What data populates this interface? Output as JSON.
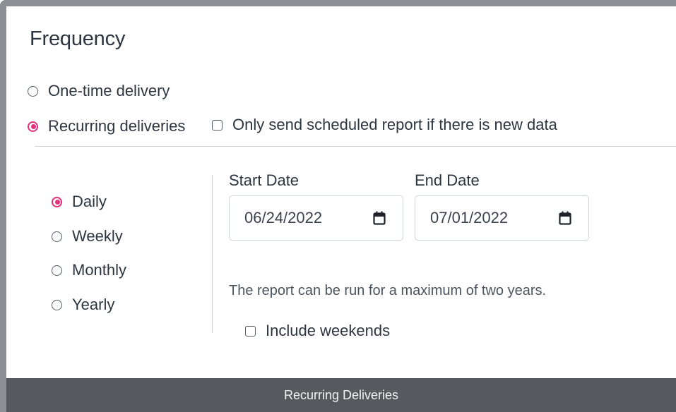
{
  "section": {
    "title": "Frequency"
  },
  "delivery_type": {
    "options": [
      {
        "label": "One-time delivery",
        "selected": false
      },
      {
        "label": "Recurring deliveries",
        "selected": true
      }
    ],
    "new_data_checkbox": {
      "label": "Only send scheduled report if there is new data",
      "checked": false
    }
  },
  "recurrence": {
    "options": [
      {
        "label": "Daily",
        "selected": true
      },
      {
        "label": "Weekly",
        "selected": false
      },
      {
        "label": "Monthly",
        "selected": false
      },
      {
        "label": "Yearly",
        "selected": false
      }
    ]
  },
  "dates": {
    "start_label": "Start Date",
    "start_value": "06/24/2022",
    "end_label": "End Date",
    "end_value": "07/01/2022",
    "calendar_icon": "calendar-icon"
  },
  "note": "The report can be run for a maximum of two years.",
  "weekends_checkbox": {
    "label": "Include weekends",
    "checked": false
  },
  "footer": {
    "label": "Recurring Deliveries"
  },
  "colors": {
    "accent": "#e0307a",
    "footer_bg": "#56595d",
    "frame_border": "#8c8f93"
  }
}
